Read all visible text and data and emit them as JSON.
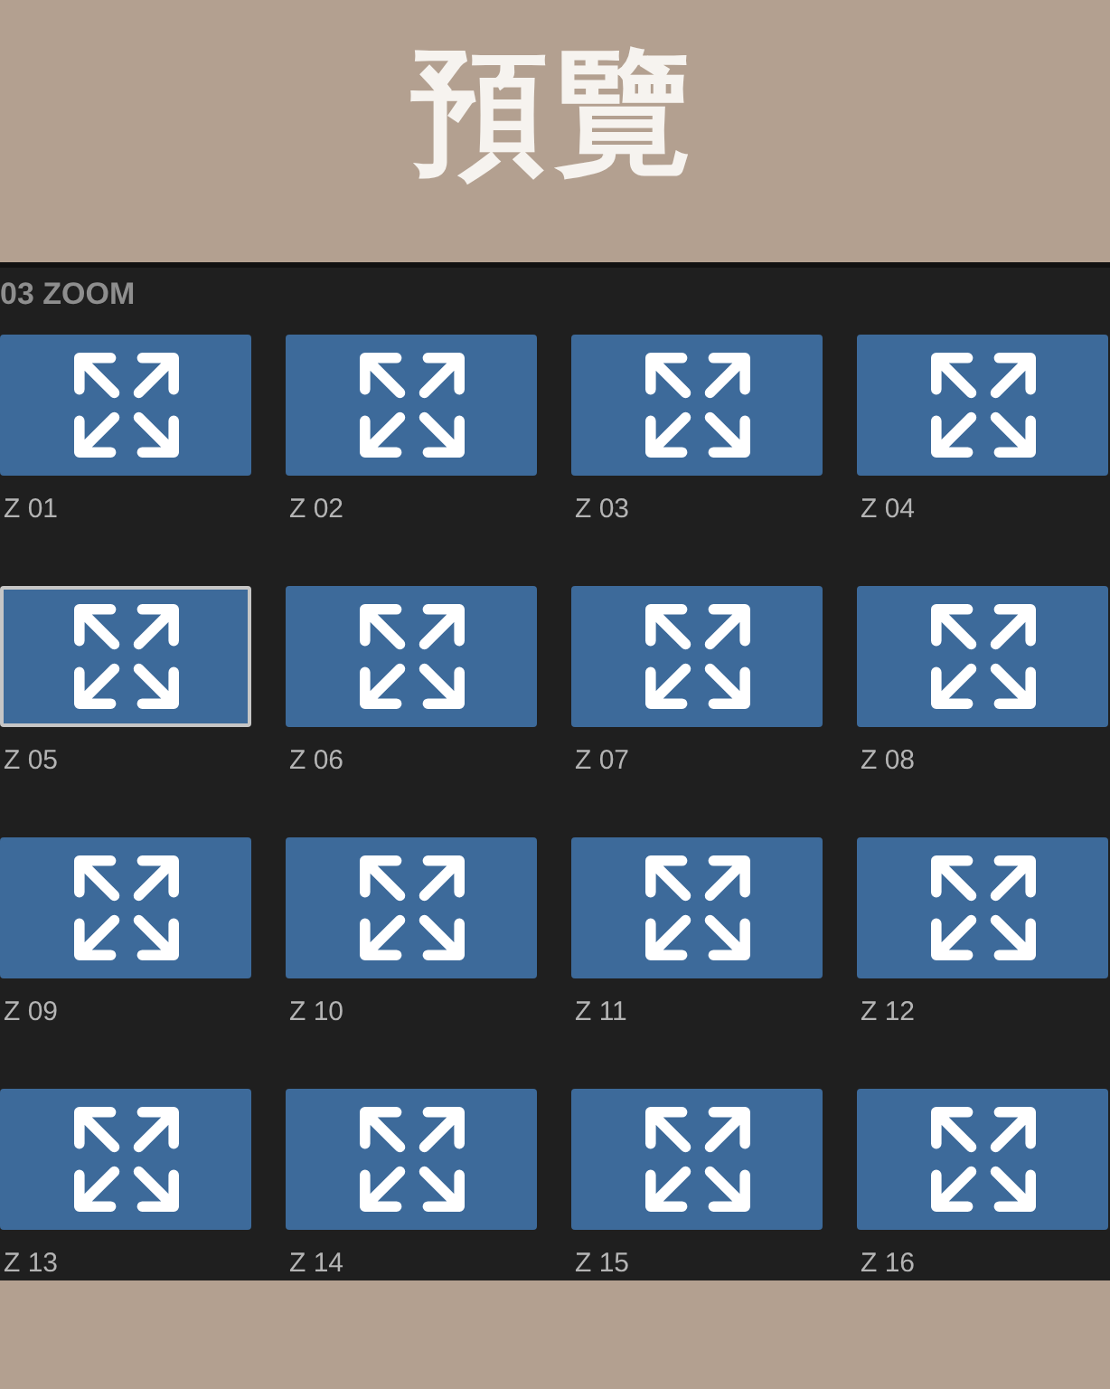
{
  "title": "預覽",
  "panel": {
    "heading": "03 ZOOM",
    "presets": [
      {
        "label": "Z 01",
        "selected": false
      },
      {
        "label": "Z 02",
        "selected": false
      },
      {
        "label": "Z 03",
        "selected": false
      },
      {
        "label": "Z 04",
        "selected": false
      },
      {
        "label": "Z 05",
        "selected": true
      },
      {
        "label": "Z 06",
        "selected": false
      },
      {
        "label": "Z 07",
        "selected": false
      },
      {
        "label": "Z 08",
        "selected": false
      },
      {
        "label": "Z 09",
        "selected": false
      },
      {
        "label": "Z 10",
        "selected": false
      },
      {
        "label": "Z 11",
        "selected": false
      },
      {
        "label": "Z 12",
        "selected": false
      },
      {
        "label": "Z 13",
        "selected": false
      },
      {
        "label": "Z 14",
        "selected": false
      },
      {
        "label": "Z 15",
        "selected": false
      },
      {
        "label": "Z 16",
        "selected": false
      }
    ]
  }
}
